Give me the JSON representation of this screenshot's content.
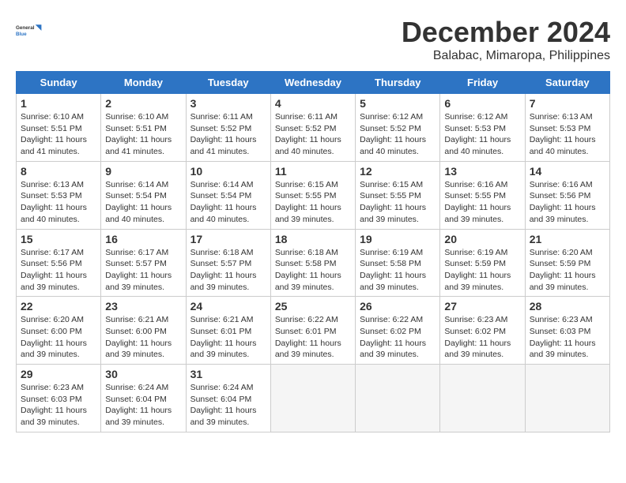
{
  "header": {
    "logo_line1": "General",
    "logo_line2": "Blue",
    "month_year": "December 2024",
    "location": "Balabac, Mimaropa, Philippines"
  },
  "columns": [
    "Sunday",
    "Monday",
    "Tuesday",
    "Wednesday",
    "Thursday",
    "Friday",
    "Saturday"
  ],
  "weeks": [
    [
      {
        "day": "1",
        "sunrise": "6:10 AM",
        "sunset": "5:51 PM",
        "daylight": "11 hours and 41 minutes."
      },
      {
        "day": "2",
        "sunrise": "6:10 AM",
        "sunset": "5:51 PM",
        "daylight": "11 hours and 41 minutes."
      },
      {
        "day": "3",
        "sunrise": "6:11 AM",
        "sunset": "5:52 PM",
        "daylight": "11 hours and 41 minutes."
      },
      {
        "day": "4",
        "sunrise": "6:11 AM",
        "sunset": "5:52 PM",
        "daylight": "11 hours and 40 minutes."
      },
      {
        "day": "5",
        "sunrise": "6:12 AM",
        "sunset": "5:52 PM",
        "daylight": "11 hours and 40 minutes."
      },
      {
        "day": "6",
        "sunrise": "6:12 AM",
        "sunset": "5:53 PM",
        "daylight": "11 hours and 40 minutes."
      },
      {
        "day": "7",
        "sunrise": "6:13 AM",
        "sunset": "5:53 PM",
        "daylight": "11 hours and 40 minutes."
      }
    ],
    [
      {
        "day": "8",
        "sunrise": "6:13 AM",
        "sunset": "5:53 PM",
        "daylight": "11 hours and 40 minutes."
      },
      {
        "day": "9",
        "sunrise": "6:14 AM",
        "sunset": "5:54 PM",
        "daylight": "11 hours and 40 minutes."
      },
      {
        "day": "10",
        "sunrise": "6:14 AM",
        "sunset": "5:54 PM",
        "daylight": "11 hours and 40 minutes."
      },
      {
        "day": "11",
        "sunrise": "6:15 AM",
        "sunset": "5:55 PM",
        "daylight": "11 hours and 39 minutes."
      },
      {
        "day": "12",
        "sunrise": "6:15 AM",
        "sunset": "5:55 PM",
        "daylight": "11 hours and 39 minutes."
      },
      {
        "day": "13",
        "sunrise": "6:16 AM",
        "sunset": "5:55 PM",
        "daylight": "11 hours and 39 minutes."
      },
      {
        "day": "14",
        "sunrise": "6:16 AM",
        "sunset": "5:56 PM",
        "daylight": "11 hours and 39 minutes."
      }
    ],
    [
      {
        "day": "15",
        "sunrise": "6:17 AM",
        "sunset": "5:56 PM",
        "daylight": "11 hours and 39 minutes."
      },
      {
        "day": "16",
        "sunrise": "6:17 AM",
        "sunset": "5:57 PM",
        "daylight": "11 hours and 39 minutes."
      },
      {
        "day": "17",
        "sunrise": "6:18 AM",
        "sunset": "5:57 PM",
        "daylight": "11 hours and 39 minutes."
      },
      {
        "day": "18",
        "sunrise": "6:18 AM",
        "sunset": "5:58 PM",
        "daylight": "11 hours and 39 minutes."
      },
      {
        "day": "19",
        "sunrise": "6:19 AM",
        "sunset": "5:58 PM",
        "daylight": "11 hours and 39 minutes."
      },
      {
        "day": "20",
        "sunrise": "6:19 AM",
        "sunset": "5:59 PM",
        "daylight": "11 hours and 39 minutes."
      },
      {
        "day": "21",
        "sunrise": "6:20 AM",
        "sunset": "5:59 PM",
        "daylight": "11 hours and 39 minutes."
      }
    ],
    [
      {
        "day": "22",
        "sunrise": "6:20 AM",
        "sunset": "6:00 PM",
        "daylight": "11 hours and 39 minutes."
      },
      {
        "day": "23",
        "sunrise": "6:21 AM",
        "sunset": "6:00 PM",
        "daylight": "11 hours and 39 minutes."
      },
      {
        "day": "24",
        "sunrise": "6:21 AM",
        "sunset": "6:01 PM",
        "daylight": "11 hours and 39 minutes."
      },
      {
        "day": "25",
        "sunrise": "6:22 AM",
        "sunset": "6:01 PM",
        "daylight": "11 hours and 39 minutes."
      },
      {
        "day": "26",
        "sunrise": "6:22 AM",
        "sunset": "6:02 PM",
        "daylight": "11 hours and 39 minutes."
      },
      {
        "day": "27",
        "sunrise": "6:23 AM",
        "sunset": "6:02 PM",
        "daylight": "11 hours and 39 minutes."
      },
      {
        "day": "28",
        "sunrise": "6:23 AM",
        "sunset": "6:03 PM",
        "daylight": "11 hours and 39 minutes."
      }
    ],
    [
      {
        "day": "29",
        "sunrise": "6:23 AM",
        "sunset": "6:03 PM",
        "daylight": "11 hours and 39 minutes."
      },
      {
        "day": "30",
        "sunrise": "6:24 AM",
        "sunset": "6:04 PM",
        "daylight": "11 hours and 39 minutes."
      },
      {
        "day": "31",
        "sunrise": "6:24 AM",
        "sunset": "6:04 PM",
        "daylight": "11 hours and 39 minutes."
      },
      null,
      null,
      null,
      null
    ]
  ],
  "labels": {
    "sunrise": "Sunrise:",
    "sunset": "Sunset:",
    "daylight": "Daylight:"
  }
}
